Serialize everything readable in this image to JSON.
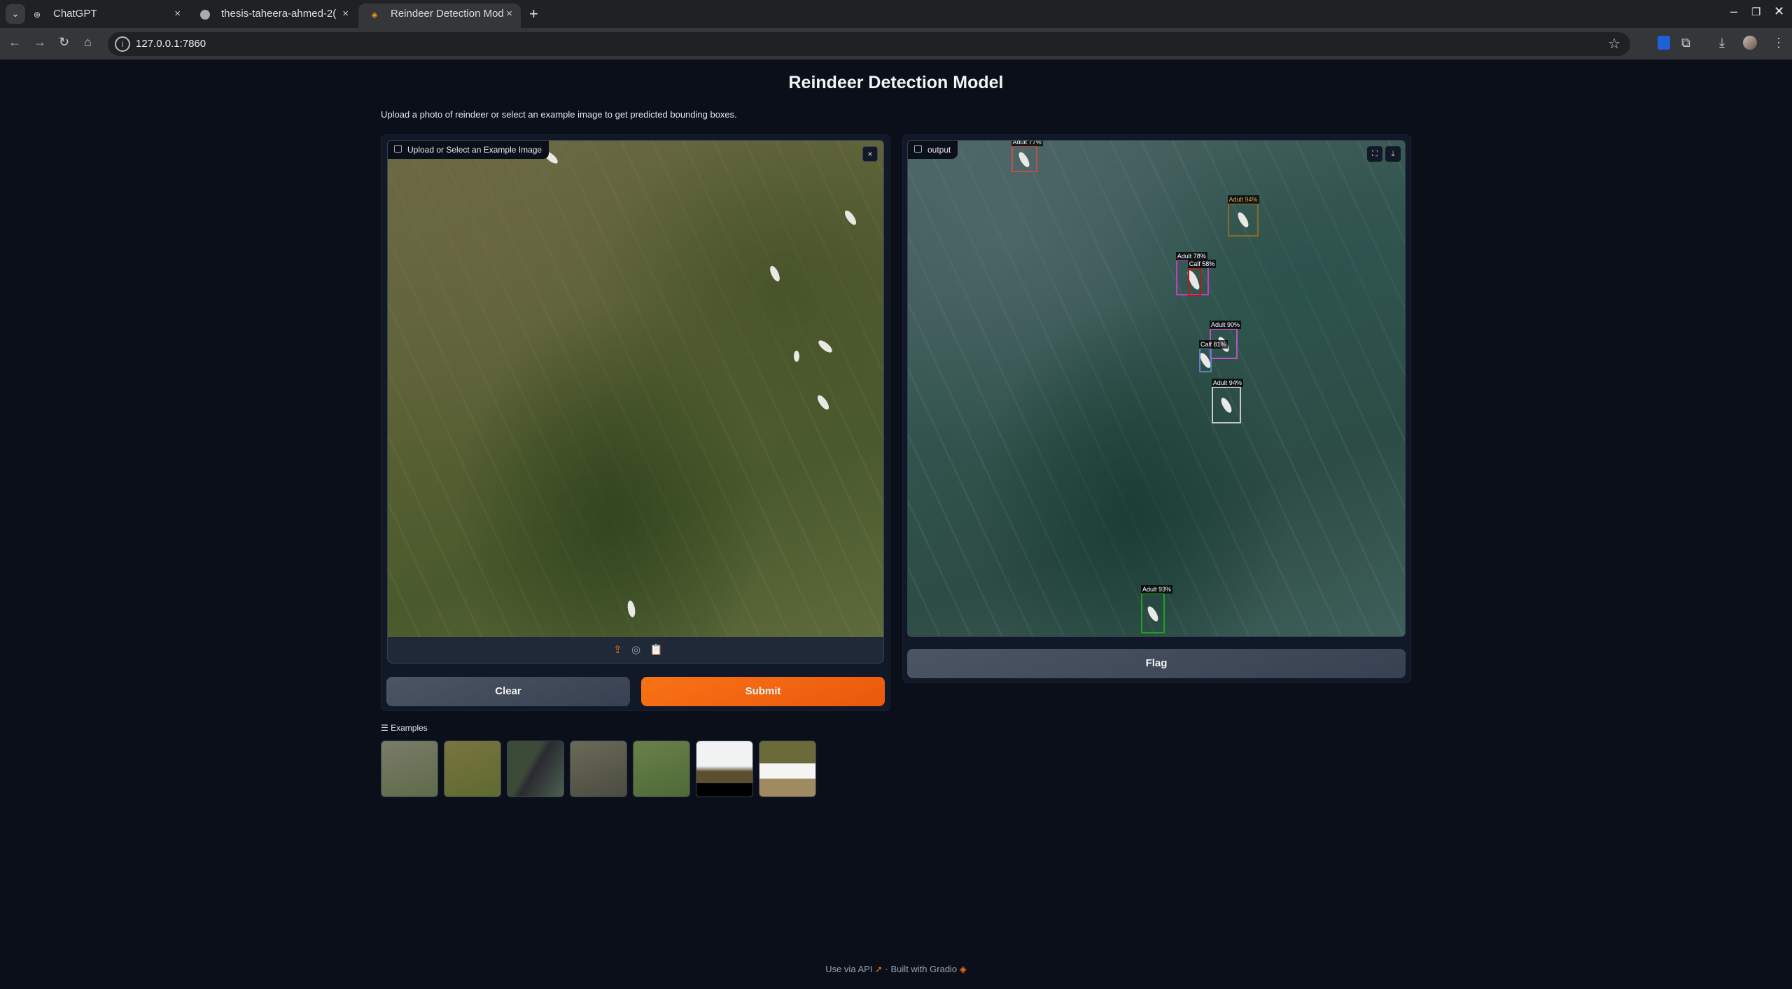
{
  "browser": {
    "tabs": [
      {
        "title": "ChatGPT",
        "icon": "openai-icon",
        "active": false
      },
      {
        "title": "thesis-taheera-ahmed-2(",
        "icon": "globe-icon",
        "active": false
      },
      {
        "title": "Reindeer Detection Mod",
        "icon": "gradio-icon",
        "active": true
      }
    ],
    "url": "127.0.0.1:7860"
  },
  "page": {
    "title": "Reindeer Detection Model",
    "description": "Upload a photo of reindeer or select an example image to get predicted bounding boxes."
  },
  "input": {
    "label": "Upload or Select an Example Image",
    "close": "×"
  },
  "output": {
    "label": "output",
    "detections": [
      {
        "label": "Adult 77%",
        "class": "Adult",
        "score": 0.77,
        "color": "#c0504d"
      },
      {
        "label": "Adult 94%",
        "class": "Adult",
        "score": 0.94,
        "color": "#8a6a2a"
      },
      {
        "label": "Adult 78%",
        "class": "Adult",
        "score": 0.78,
        "color": "#c040c0"
      },
      {
        "label": "Calf 58%",
        "class": "Calf",
        "score": 0.58,
        "color": "#c01515"
      },
      {
        "label": "Adult 90%",
        "class": "Adult",
        "score": 0.9,
        "color": "#c050c0"
      },
      {
        "label": "Calf 81%",
        "class": "Calf",
        "score": 0.81,
        "color": "#6080c0"
      },
      {
        "label": "Adult 94%",
        "class": "Adult",
        "score": 0.94,
        "color": "#c8c8c8"
      },
      {
        "label": "Adult 93%",
        "class": "Adult",
        "score": 0.93,
        "color": "#20a020"
      }
    ]
  },
  "buttons": {
    "clear": "Clear",
    "submit": "Submit",
    "flag": "Flag"
  },
  "examples": {
    "label": "Examples",
    "count": 7
  },
  "footer": {
    "api": "Use via API",
    "sep": "·",
    "built": "Built with Gradio"
  },
  "colors": {
    "accent": "#f97316",
    "background": "#0b0f19",
    "panel": "#111827"
  }
}
